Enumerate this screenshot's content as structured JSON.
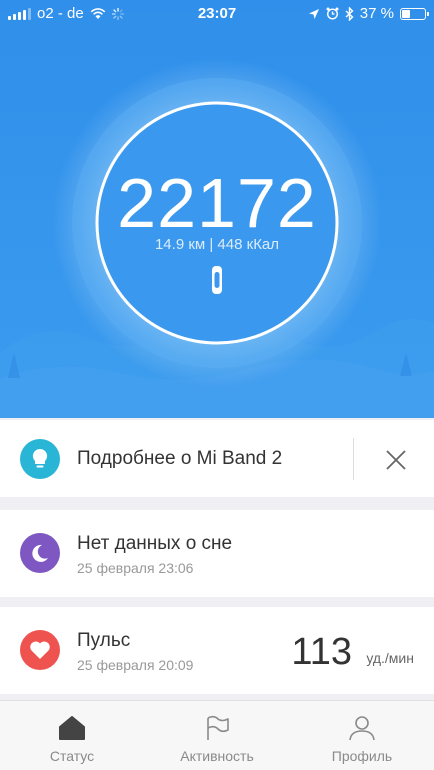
{
  "status_bar": {
    "carrier": "o2 - de",
    "time": "23:07",
    "battery": "37 %",
    "battery_level": 0.37
  },
  "hero": {
    "steps": "22172",
    "distance_calories": "14.9 км | 448 кКал"
  },
  "cards": {
    "promo": {
      "title": "Подробнее о Mi Band 2"
    },
    "sleep": {
      "title": "Нет данных о сне",
      "date": "25 февраля 23:06"
    },
    "pulse": {
      "title": "Пульс",
      "date": "25 февраля 20:09",
      "value": "113",
      "unit": "уд./мин"
    }
  },
  "tabbar": {
    "status": "Статус",
    "activity": "Активность",
    "profile": "Профиль"
  },
  "colors": {
    "hero_blue": "#3595ec",
    "promo_circle": "#29b5d6",
    "sleep_circle": "#7e57c2",
    "pulse_circle": "#ef5350"
  }
}
